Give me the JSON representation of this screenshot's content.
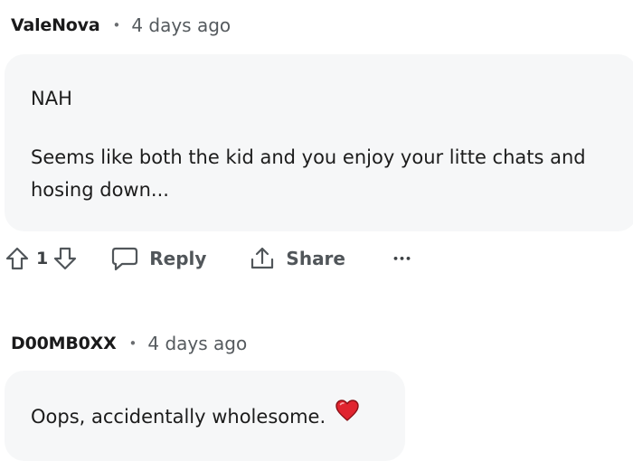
{
  "comments": [
    {
      "username": "ValeNova",
      "separator": "•",
      "time": "4 days ago",
      "paragraphs": [
        "NAH",
        "Seems like both the kid and you enjoy your litte chats and hosing down..."
      ],
      "votes": "1",
      "actions": {
        "reply": "Reply",
        "share": "Share",
        "more": "•••"
      }
    },
    {
      "username": "D00MB0XX",
      "separator": "•",
      "time": "4 days ago",
      "text": "Oops, accidentally wholesome.",
      "emoji": "heart-emoji"
    }
  ],
  "colors": {
    "bubble": "#f6f7f8",
    "text": "#1c1c1c",
    "muted": "#555a5e",
    "icon": "#51565a",
    "heart": "#e0242f"
  }
}
